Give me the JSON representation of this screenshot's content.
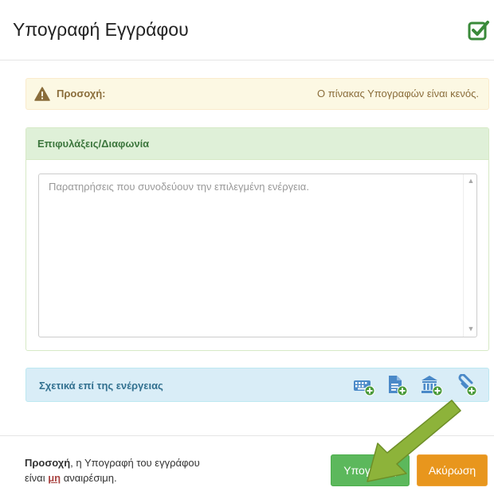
{
  "modal": {
    "title": "Υπογραφή Εγγράφου",
    "header_icon": "check-square-icon"
  },
  "warning": {
    "label": "Προσοχή:",
    "text": "Ο πίνακας Υπογραφών είναι κενός."
  },
  "notes_panel": {
    "title": "Επιφυλάξεις/Διαφωνία",
    "placeholder": "Παρατηρήσεις που συνοδεύουν την επιλεγμένη ενέργεια.",
    "value": ""
  },
  "related_panel": {
    "title": "Σχετικά επί της ενέργειας",
    "icons": [
      "keyboard-add-icon",
      "document-add-icon",
      "institution-add-icon",
      "attachment-add-icon"
    ]
  },
  "footer": {
    "note_bold": "Προσοχή",
    "note_part1": ", η Υπογραφή του εγγράφου",
    "note_part2_a": "είναι ",
    "note_emph": "μη",
    "note_part2_b": " αναιρέσιμη.",
    "sign_button": "Υπογραφή",
    "cancel_button": "Ακύρωση"
  },
  "colors": {
    "warning_bg": "#fcf8e3",
    "success_bg": "#dff0d8",
    "info_bg": "#d9edf7",
    "sign_button": "#5cb85c",
    "cancel_button": "#e8961d",
    "arrow": "#8db33a"
  }
}
